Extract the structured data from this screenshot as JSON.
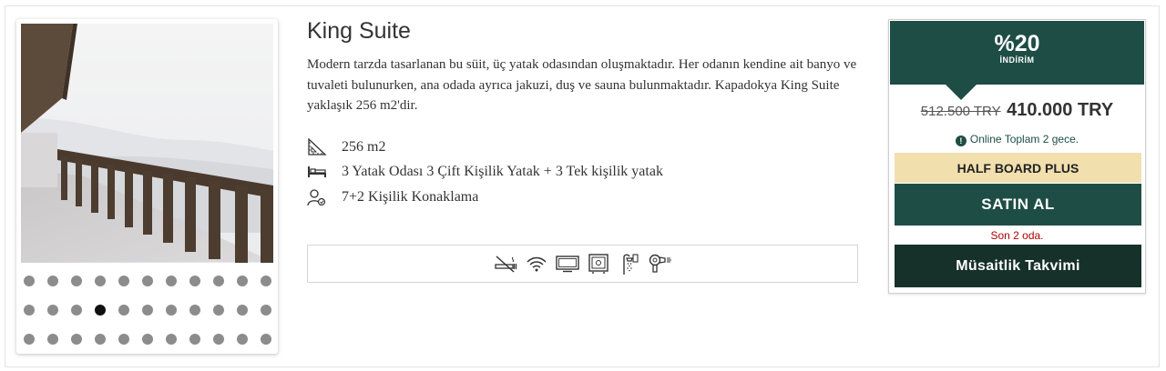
{
  "room": {
    "title": "King Suite",
    "description": "Modern tarzda tasarlanan bu süit, üç yatak odasından oluşmaktadır. Her odanın kendine ait banyo ve tuvaleti bulunurken, ana odada ayrıca jakuzi, duş ve sauna bulunmaktadır. Kapadokya King Suite yaklaşık 256 m2'dir."
  },
  "features": [
    {
      "icon": "area-icon",
      "text": "256 m2"
    },
    {
      "icon": "bed-icon",
      "text": "3 Yatak Odası 3 Çift Kişilik Yatak + 3 Tek kişilik yatak"
    },
    {
      "icon": "guests-icon",
      "text": "7+2 Kişilik Konaklama"
    }
  ],
  "amenities": [
    "no-smoking-icon",
    "wifi-icon",
    "tv-icon",
    "safe-icon",
    "shower-icon",
    "hair-dryer-icon"
  ],
  "gallery": {
    "total_photos": 33,
    "active_index": 14
  },
  "pricing": {
    "discount_percent": "%20",
    "discount_label": "İNDİRİM",
    "old_price": "512.500 TRY",
    "new_price": "410.000 TRY",
    "online_note": "Online Toplam 2 gece.",
    "board_type": "HALF BOARD PLUS",
    "buy_label": "SATIN AL",
    "availability_note": "Son 2 oda.",
    "calendar_label": "Müsaitlik Takvimi"
  },
  "colors": {
    "brand_dark_green": "#1e4d45",
    "calendar_button": "#16302a",
    "board_bg": "#f1dfae",
    "alert_red": "#b00000"
  }
}
